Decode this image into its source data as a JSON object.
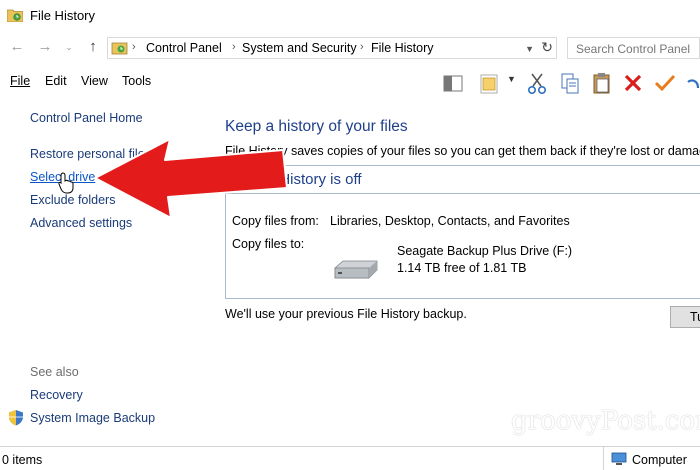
{
  "window": {
    "title": "File History"
  },
  "address": {
    "crumbs": [
      "Control Panel",
      "System and Security",
      "File History"
    ],
    "search_placeholder": "Search Control Panel"
  },
  "menu": {
    "file": "File",
    "edit": "Edit",
    "view": "View",
    "tools": "Tools"
  },
  "sidebar": {
    "home": "Control Panel Home",
    "items": [
      "Restore personal files",
      "Select drive",
      "Exclude folders",
      "Advanced settings"
    ],
    "see_also_label": "See also",
    "see_also_items": [
      "Recovery",
      "System Image Backup"
    ]
  },
  "main": {
    "title": "Keep a history of your files",
    "description": "File History saves copies of your files so you can get them back if they're lost or damaged.",
    "status_title": "File History is off",
    "copy_from_label": "Copy files from:",
    "copy_from_value": "Libraries, Desktop, Contacts, and Favorites",
    "copy_to_label": "Copy files to:",
    "drive_name": "Seagate Backup Plus Drive (F:)",
    "drive_space": "1.14 TB free of 1.81 TB",
    "backup_note": "We'll use your previous File History backup.",
    "turn_on_button": "Tu"
  },
  "statusbar": {
    "items": "0 items",
    "location": "Computer"
  },
  "watermark": "groovyPost.com",
  "colors": {
    "link": "#1a3b7a",
    "heading": "#1e3f8a",
    "arrow": "#e31b1b",
    "border": "#a9bad1"
  }
}
